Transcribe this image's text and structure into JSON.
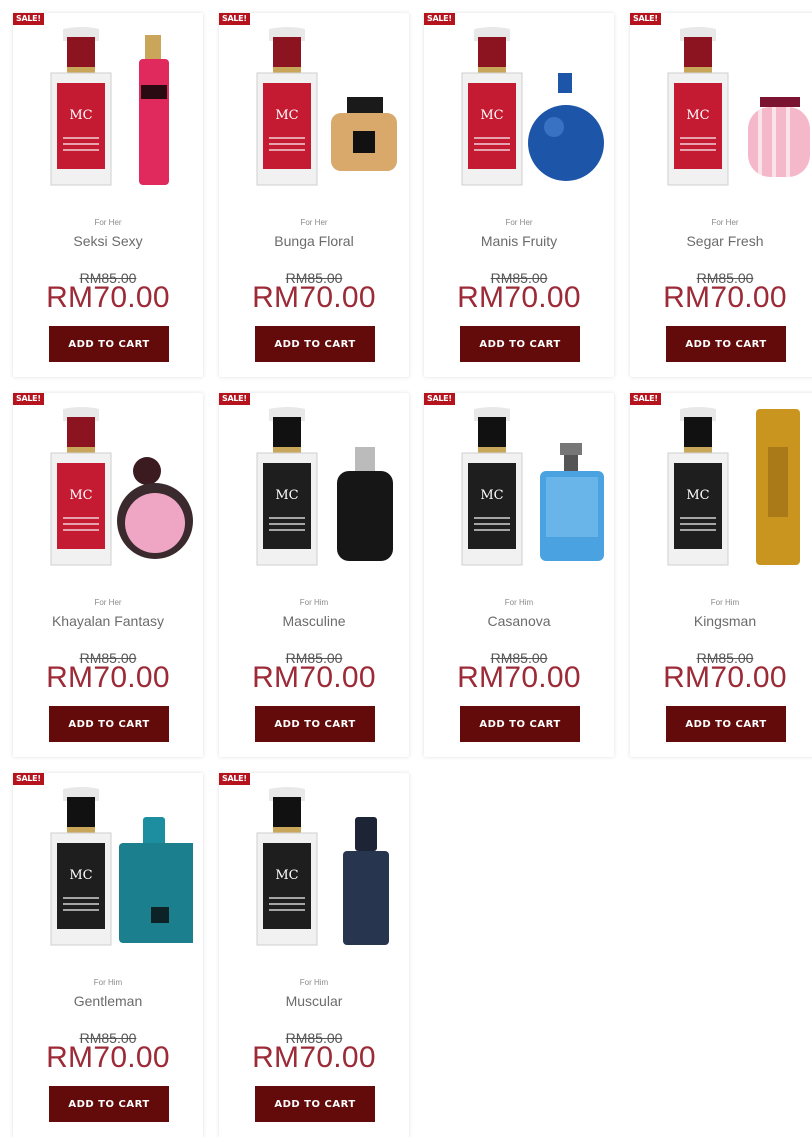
{
  "sale_badge": "SALE!",
  "products": [
    {
      "gender": "For Her",
      "name": "Seksi Sexy",
      "old_price": "RM85.00",
      "new_price": "RM70.00",
      "cta": "ADD TO CART",
      "mc_color": "#c41b33",
      "cap_color": "#8c1420",
      "companion": "pink-spray-bottle-icon",
      "companion_color": "#e0295d"
    },
    {
      "gender": "For Her",
      "name": "Bunga Floral",
      "old_price": "RM85.00",
      "new_price": "RM70.00",
      "cta": "ADD TO CART",
      "mc_color": "#c41b33",
      "cap_color": "#8c1420",
      "companion": "gold-floral-bottle-icon",
      "companion_color": "#d9a86b"
    },
    {
      "gender": "For Her",
      "name": "Manis Fruity",
      "old_price": "RM85.00",
      "new_price": "RM70.00",
      "cta": "ADD TO CART",
      "mc_color": "#c41b33",
      "cap_color": "#8c1420",
      "companion": "blue-round-bottle-icon",
      "companion_color": "#1d55a8"
    },
    {
      "gender": "For Her",
      "name": "Segar Fresh",
      "old_price": "RM85.00",
      "new_price": "RM70.00",
      "cta": "ADD TO CART",
      "mc_color": "#c41b33",
      "cap_color": "#8c1420",
      "companion": "pink-striped-bottle-icon",
      "companion_color": "#f4b8ca"
    },
    {
      "gender": "For Her",
      "name": "Khayalan Fantasy",
      "old_price": "RM85.00",
      "new_price": "RM70.00",
      "cta": "ADD TO CART",
      "mc_color": "#c41b33",
      "cap_color": "#8c1420",
      "companion": "pink-disc-bottle-icon",
      "companion_color": "#efa6c4"
    },
    {
      "gender": "For Him",
      "name": "Masculine",
      "old_price": "RM85.00",
      "new_price": "RM70.00",
      "cta": "ADD TO CART",
      "mc_color": "#1e1e1e",
      "cap_color": "#111111",
      "companion": "black-square-bottle-icon",
      "companion_color": "#161616"
    },
    {
      "gender": "For Him",
      "name": "Casanova",
      "old_price": "RM85.00",
      "new_price": "RM70.00",
      "cta": "ADD TO CART",
      "mc_color": "#1e1e1e",
      "cap_color": "#111111",
      "companion": "light-blue-bottle-icon",
      "companion_color": "#4aa3e0"
    },
    {
      "gender": "For Him",
      "name": "Kingsman",
      "old_price": "RM85.00",
      "new_price": "RM70.00",
      "cta": "ADD TO CART",
      "mc_color": "#1e1e1e",
      "cap_color": "#111111",
      "companion": "gold-bar-bottle-icon",
      "companion_color": "#c9951f"
    },
    {
      "gender": "For Him",
      "name": "Gentleman",
      "old_price": "RM85.00",
      "new_price": "RM70.00",
      "cta": "ADD TO CART",
      "mc_color": "#1e1e1e",
      "cap_color": "#111111",
      "companion": "teal-square-bottle-icon",
      "companion_color": "#1b7f8e"
    },
    {
      "gender": "For Him",
      "name": "Muscular",
      "old_price": "RM85.00",
      "new_price": "RM70.00",
      "cta": "ADD TO CART",
      "mc_color": "#1e1e1e",
      "cap_color": "#111111",
      "companion": "navy-tall-bottle-icon",
      "companion_color": "#27354f"
    }
  ]
}
